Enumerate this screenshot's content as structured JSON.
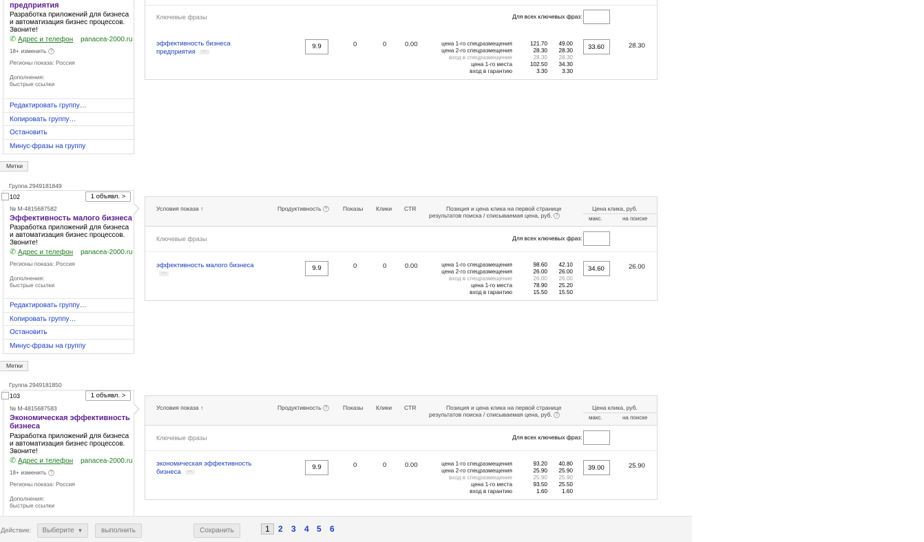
{
  "common": {
    "ad_desc": "Разработка приложений для бизнеса и автоматизация бизнес процессов. Звоните!",
    "addr_link": "Адрес и телефон",
    "domain": "panacea-2000.ru",
    "age_label": "18+",
    "age_change": "изменить",
    "regions": "Регионы показа: Россия",
    "extras_label": "Дополнения:",
    "extras_value": "быстрые ссылки",
    "menu": [
      "Редактировать группу…",
      "Копировать группу…",
      "Остановить",
      "Минус-фразы на группу"
    ],
    "tags_button": "Метки",
    "ad_button": "1 объявл. >",
    "col_conditions": "Условия показа ↑",
    "col_productivity": "Продуктивность",
    "col_shows": "Показы",
    "col_clicks": "Клики",
    "col_ctr": "CTR",
    "col_position_1": "Позиция и цена клика на первой странице",
    "col_position_2": "результатов поиска / списываемая цена, руб.",
    "col_price": "Цена клика, руб.",
    "col_max": "макс.",
    "col_search": "на поиске",
    "kw_label": "Ключевые фразы",
    "all_kw_label": "Для всех ключевых фраз:",
    "bid_labels": [
      "цена 1-го спецразмещения",
      "цена 2-го спецразмещения",
      "вход в спецразмещение",
      "цена 1-го места",
      "вход в гарантию"
    ]
  },
  "groups": [
    {
      "title": "предприятия",
      "phrase": "эффективность бизнеса предприятия",
      "productivity": "9.9",
      "shows": "0",
      "clicks": "0",
      "ctr": "0.00",
      "bids": [
        [
          "121.70",
          "49.00"
        ],
        [
          "28.30",
          "28.30"
        ],
        [
          "28.30",
          "28.30"
        ],
        [
          "102.50",
          "34.30"
        ],
        [
          "3.30",
          "3.30"
        ]
      ],
      "max": "33.60",
      "search": "28.30"
    },
    {
      "group_label": "Группа 2949181849",
      "num": "102",
      "ad_id": "№ M-4815687582",
      "title": "Эффективность малого бизнеса",
      "phrase": "эффективность малого бизнеса",
      "productivity": "9.9",
      "shows": "0",
      "clicks": "0",
      "ctr": "0.00",
      "bids": [
        [
          "98.60",
          "42.10"
        ],
        [
          "26.00",
          "26.00"
        ],
        [
          "26.00",
          "26.00"
        ],
        [
          "78.90",
          "25.20"
        ],
        [
          "15.50",
          "15.50"
        ]
      ],
      "max": "34.60",
      "search": "26.00"
    },
    {
      "group_label": "Группа 2949181850",
      "num": "103",
      "ad_id": "№ M-4815687583",
      "title": "Экономическая эффективность бизнеса",
      "phrase": "экономическая эффективность бизнеса",
      "productivity": "9.9",
      "shows": "0",
      "clicks": "0",
      "ctr": "0.00",
      "bids": [
        [
          "93.20",
          "40.80"
        ],
        [
          "25.90",
          "25.90"
        ],
        [
          "25.90",
          "25.90"
        ],
        [
          "93.50",
          "25.50"
        ],
        [
          "1.60",
          "1.60"
        ]
      ],
      "max": "39.00",
      "search": "25.90"
    }
  ],
  "bottom": {
    "action_label": "Действие:",
    "select_label": "Выберите",
    "run_label": "выполнить",
    "save_label": "Сохранить",
    "pages": [
      "1",
      "2",
      "3",
      "4",
      "5",
      "6"
    ]
  }
}
